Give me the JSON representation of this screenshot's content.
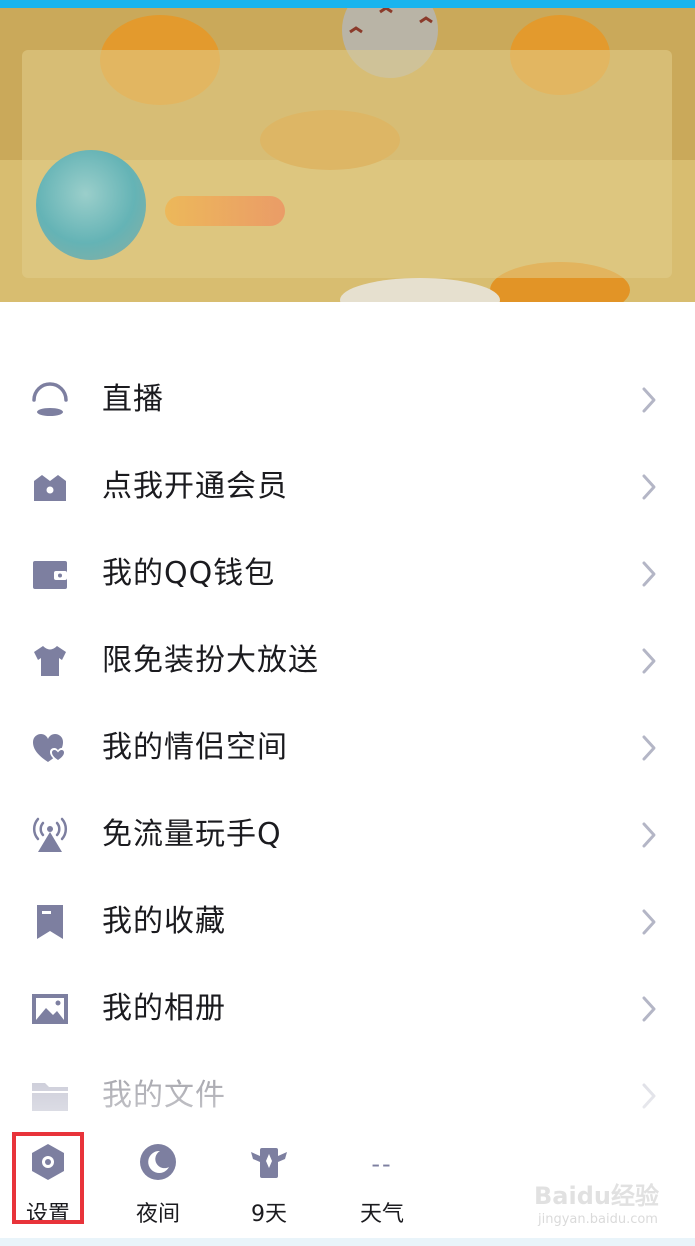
{
  "menu": {
    "items": [
      {
        "label": "直播",
        "icon": "live-icon"
      },
      {
        "label": "点我开通会员",
        "icon": "crown-icon"
      },
      {
        "label": "我的QQ钱包",
        "icon": "wallet-icon"
      },
      {
        "label": "限免装扮大放送",
        "icon": "tshirt-icon"
      },
      {
        "label": "我的情侣空间",
        "icon": "hearts-icon"
      },
      {
        "label": "免流量玩手Q",
        "icon": "signal-tower-icon"
      },
      {
        "label": "我的收藏",
        "icon": "bookmark-icon"
      },
      {
        "label": "我的相册",
        "icon": "photo-album-icon"
      },
      {
        "label": "我的文件",
        "icon": "folder-icon"
      }
    ]
  },
  "bottom_bar": {
    "settings_label": "设置",
    "night_label": "夜间",
    "streak_label": "9天",
    "weather_value": "--",
    "weather_label": "天气"
  },
  "watermark": {
    "text": "Baidu经验",
    "sub": "jingyan.baidu.com"
  },
  "colors": {
    "icon": "#7d7fa0",
    "chevron": "#b4b6c6",
    "highlight": "#e8333a",
    "top_bar": "#19b4ee"
  }
}
